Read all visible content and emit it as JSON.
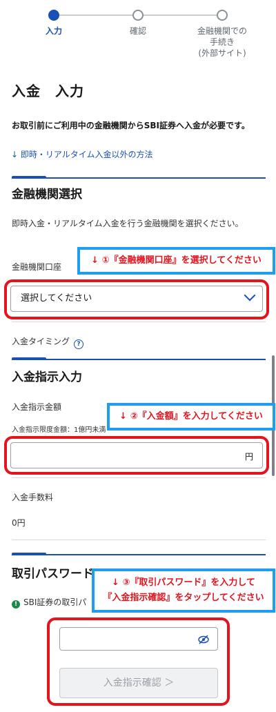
{
  "stepper": {
    "steps": [
      {
        "label": "入力"
      },
      {
        "label": "確認"
      },
      {
        "label": "金融機関での\n手続き\n(外部サイト)"
      }
    ]
  },
  "page": {
    "title": "入金　入力",
    "notice": "お取引前にご利用中の金融機関からSBI証券へ入金が必要です。",
    "other_methods_link": "↓ 即時・リアルタイム入金以外の方法"
  },
  "institution": {
    "section_title": "金融機関選択",
    "description": "即時入金・リアルタイム入金を行う金融機関を選択ください。",
    "account_label": "金融機関口座",
    "select_value": "選択してください",
    "timing_label": "入金タイミング"
  },
  "instruction": {
    "section_title": "入金指示入力",
    "amount_label": "入金指示金額",
    "limit_text": "入金指示限度金額：1億円未満",
    "amount_value": "",
    "unit": "円",
    "fee_label": "入金手数料",
    "fee_value": "0円"
  },
  "password": {
    "section_title": "取引パスワード",
    "info_text": "SBI証券の取引パ",
    "value": "",
    "confirm_button": "入金指示確認 ＞"
  },
  "annotations": {
    "step1": "↓ ①『金融機関口座』を選択してください",
    "step2": "↓ ②『入金額』を入力してください",
    "step3_line1": "↓ ③『取引パスワード』を入力して",
    "step3_line2": "『入金指示確認』をタップしてください"
  },
  "colors": {
    "accent": "#1a4fb8",
    "annotation_red": "#e4141e",
    "annotation_blue": "#1e9ef0"
  }
}
